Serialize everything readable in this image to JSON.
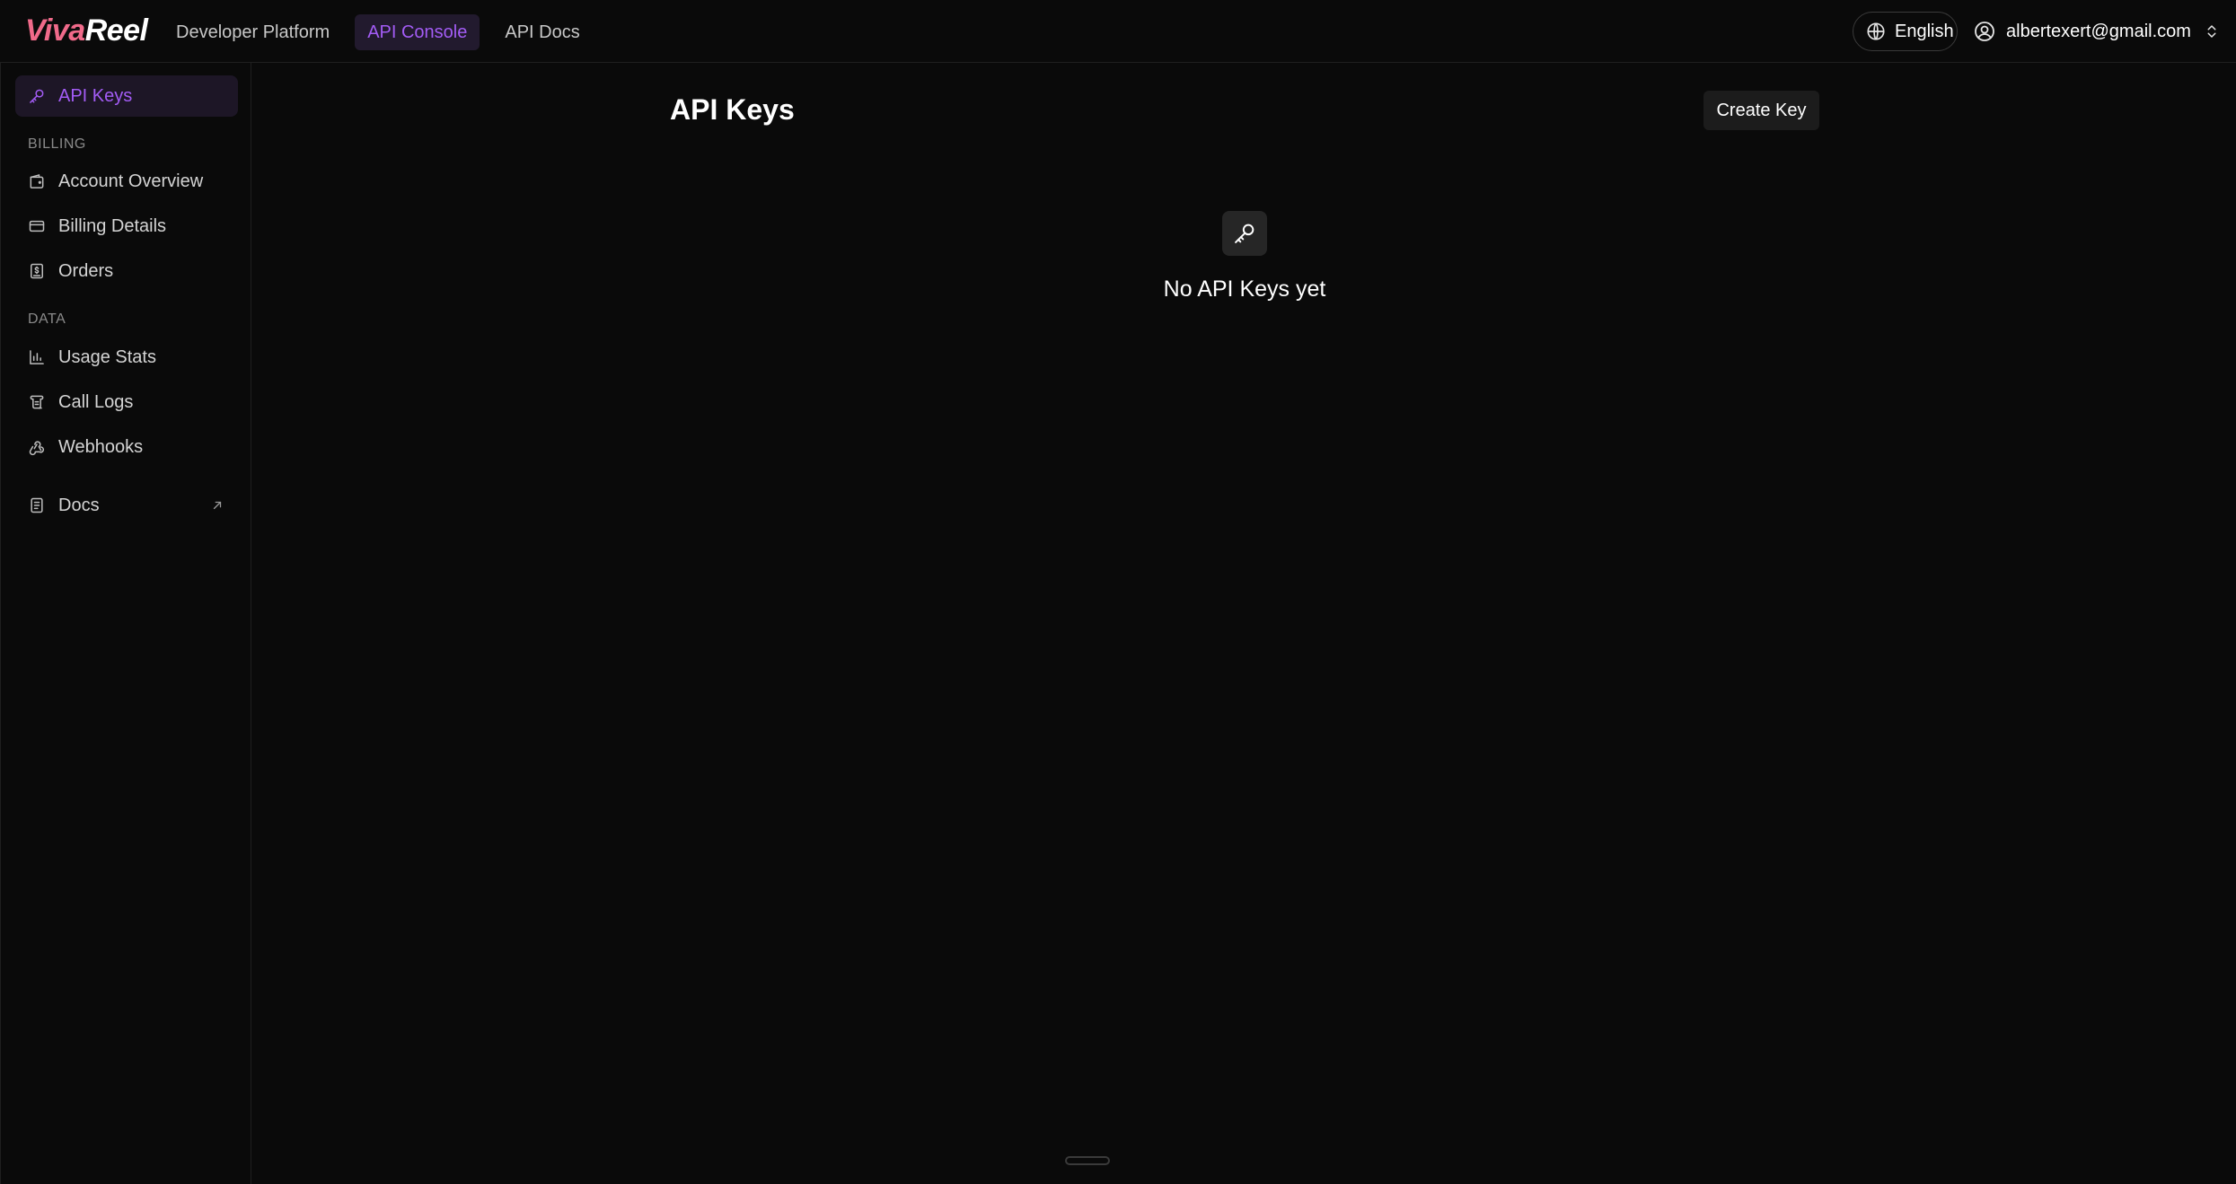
{
  "header": {
    "logo": {
      "part1": "Viva",
      "part2": "Reel"
    },
    "nav": [
      {
        "label": "Developer Platform"
      },
      {
        "label": "API Console"
      },
      {
        "label": "API Docs"
      }
    ],
    "active_nav": "API Console",
    "language": "English",
    "user_email": "albertexert@gmail.com"
  },
  "sidebar": {
    "items": [
      {
        "label": "API Keys",
        "icon": "key-icon"
      },
      {
        "label": "Account Overview",
        "icon": "wallet-icon"
      },
      {
        "label": "Billing Details",
        "icon": "credit-card-icon"
      },
      {
        "label": "Orders",
        "icon": "receipt-icon"
      },
      {
        "label": "Usage Stats",
        "icon": "bar-chart-icon"
      },
      {
        "label": "Call Logs",
        "icon": "scroll-icon"
      },
      {
        "label": "Webhooks",
        "icon": "webhook-icon"
      },
      {
        "label": "Docs",
        "icon": "document-icon"
      }
    ],
    "sections": {
      "billing": "BILLING",
      "data": "DATA"
    }
  },
  "main": {
    "title": "API Keys",
    "create_button": "Create Key",
    "empty_state": "No API Keys yet"
  },
  "colors": {
    "accent": "#a35cf5",
    "background": "#0a0a0a",
    "logo_gradient_start": "#f06a8a"
  }
}
